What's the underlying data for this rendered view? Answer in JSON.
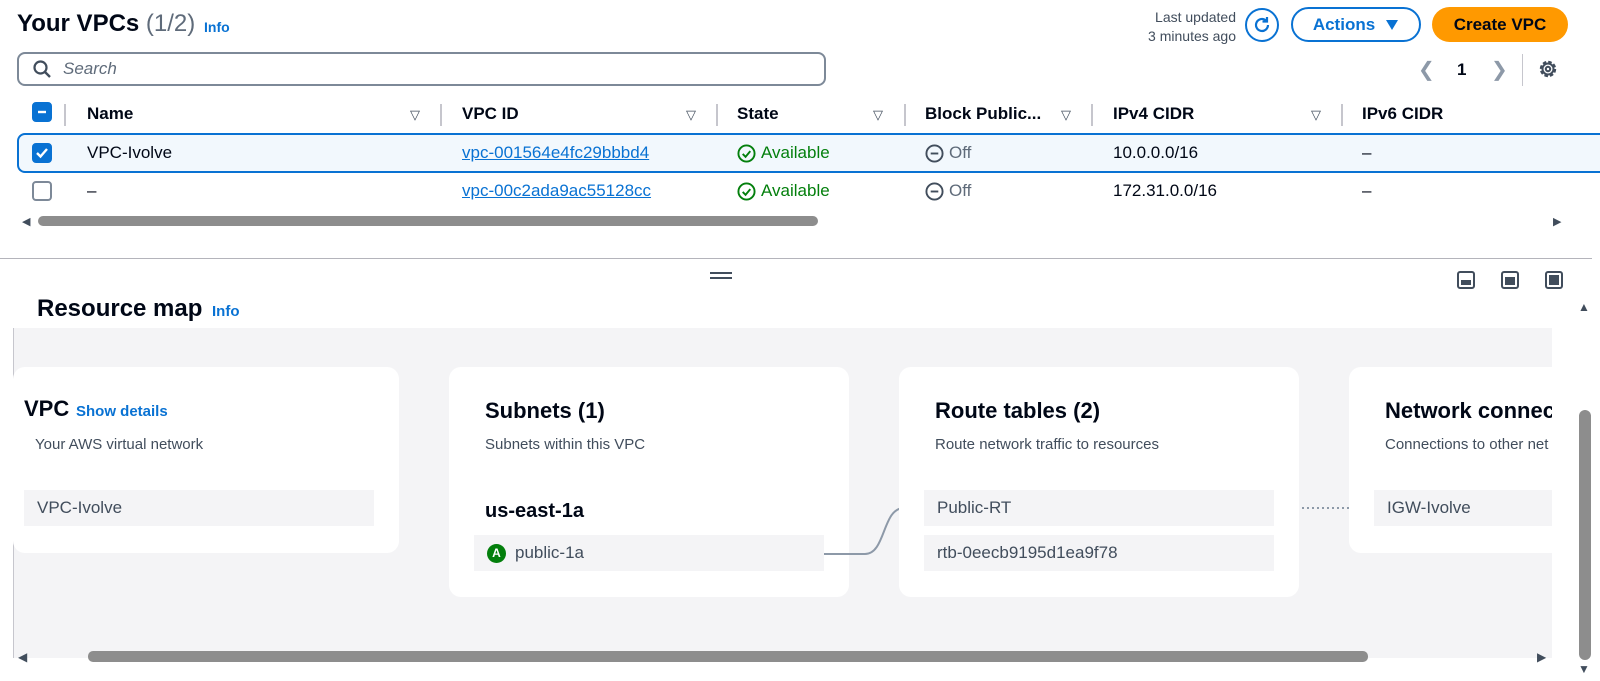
{
  "header": {
    "title": "Your VPCs",
    "count": "(1/2)",
    "info": "Info",
    "last_updated_line1": "Last updated",
    "last_updated_line2": "3 minutes ago",
    "refresh_icon": "refresh-icon",
    "actions_label": "Actions",
    "create_label": "Create VPC"
  },
  "search": {
    "placeholder": "Search",
    "value": ""
  },
  "pagination": {
    "page": "1"
  },
  "table": {
    "columns": [
      "Name",
      "VPC ID",
      "State",
      "Block Public...",
      "IPv4 CIDR",
      "IPv6 CIDR"
    ],
    "rows": [
      {
        "selected": true,
        "name": "VPC-Ivolve",
        "vpc_id": "vpc-001564e4fc29bbbd4",
        "state": "Available",
        "block_public": "Off",
        "ipv4": "10.0.0.0/16",
        "ipv6": "–"
      },
      {
        "selected": false,
        "name": "–",
        "vpc_id": "vpc-00c2ada9ac55128cc",
        "state": "Available",
        "block_public": "Off",
        "ipv4": "172.31.0.0/16",
        "ipv6": "–"
      }
    ]
  },
  "resource_map": {
    "title": "Resource map",
    "info": "Info",
    "vpc_card": {
      "title": "VPC",
      "link": "Show details",
      "subtitle": "Your AWS virtual network",
      "item": "VPC-Ivolve"
    },
    "subnets_card": {
      "title": "Subnets (1)",
      "subtitle": "Subnets within this VPC",
      "az": "us-east-1a",
      "badge": "A",
      "item": "public-1a"
    },
    "route_card": {
      "title": "Route tables (2)",
      "subtitle": "Route network traffic to resources",
      "items": [
        "Public-RT",
        "rtb-0eecb9195d1ea9f78"
      ]
    },
    "network_card": {
      "title": "Network connec",
      "subtitle": "Connections to other net",
      "item": "IGW-Ivolve"
    }
  },
  "colors": {
    "accent": "#0972d3",
    "primary_button": "#ff9900",
    "success": "#037f0c"
  }
}
